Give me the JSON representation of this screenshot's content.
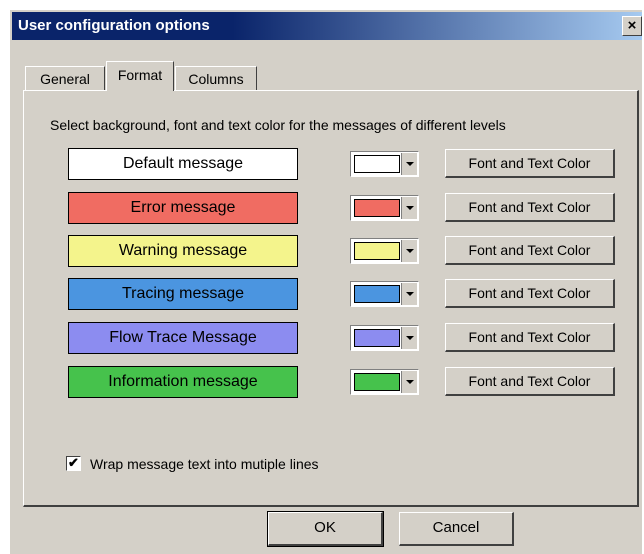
{
  "window": {
    "title": "User configuration options",
    "close_glyph": "×"
  },
  "tabs": [
    {
      "label": "General",
      "active": false
    },
    {
      "label": "Format",
      "active": true
    },
    {
      "label": "Columns",
      "active": false
    }
  ],
  "instructions": "Select background, font and text color for the messages of different levels",
  "message_levels": [
    {
      "label": "Default message",
      "color": "#ffffff",
      "button": "Font and Text Color"
    },
    {
      "label": "Error message",
      "color": "#f06c62",
      "button": "Font and Text Color"
    },
    {
      "label": "Warning message",
      "color": "#f4f48c",
      "button": "Font and Text Color"
    },
    {
      "label": "Tracing message",
      "color": "#4b95e0",
      "button": "Font and Text Color"
    },
    {
      "label": "Flow Trace Message",
      "color": "#8c8cf0",
      "button": "Font and Text Color"
    },
    {
      "label": "Information message",
      "color": "#46c24c",
      "button": "Font and Text Color"
    }
  ],
  "wrap_option": {
    "label": "Wrap message text into mutiple lines",
    "checked": true,
    "check_glyph": "✔"
  },
  "buttons": {
    "ok": "OK",
    "cancel": "Cancel"
  }
}
